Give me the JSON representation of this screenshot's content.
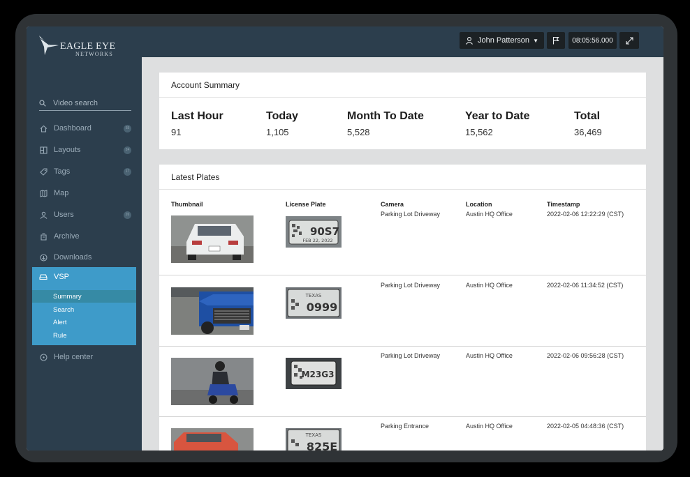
{
  "brand": {
    "name": "EAGLE EYE",
    "sub": "NETWORKS"
  },
  "header": {
    "user_name": "John Patterson",
    "clock": "08:05:56.000"
  },
  "sidebar": {
    "search_label": "Video search",
    "items": [
      {
        "label": "Dashboard",
        "badge": "55",
        "icon": "home-icon"
      },
      {
        "label": "Layouts",
        "badge": "24",
        "icon": "layouts-icon"
      },
      {
        "label": "Tags",
        "badge": "17",
        "icon": "tag-icon"
      },
      {
        "label": "Map",
        "badge": "",
        "icon": "map-icon"
      },
      {
        "label": "Users",
        "badge": "26",
        "icon": "user-icon"
      },
      {
        "label": "Archive",
        "badge": "",
        "icon": "archive-icon"
      },
      {
        "label": "Downloads",
        "badge": "",
        "icon": "download-icon"
      }
    ],
    "vsp": {
      "label": "VSP",
      "sub": [
        "Summary",
        "Search",
        "Alert",
        "Rule"
      ],
      "active": "Summary"
    },
    "help_label": "Help center"
  },
  "summary": {
    "title": "Account Summary",
    "stats": [
      {
        "label": "Last Hour",
        "value": "91"
      },
      {
        "label": "Today",
        "value": "1,105"
      },
      {
        "label": "Month To Date",
        "value": "5,528"
      },
      {
        "label": "Year to Date",
        "value": "15,562"
      },
      {
        "label": "Total",
        "value": "36,469"
      }
    ]
  },
  "plates": {
    "title": "Latest Plates",
    "columns": [
      "Thumbnail",
      "License Plate",
      "Camera",
      "Location",
      "Timestamp"
    ],
    "rows": [
      {
        "plate_text": "90S7",
        "plate_sub": "FEB 22, 2022",
        "camera": "Parking Lot Driveway",
        "location": "Austin HQ Office",
        "timestamp": "2022-02-06 12:22:29 (CST)"
      },
      {
        "plate_text": "0999",
        "plate_sub": "TEXAS",
        "camera": "Parking Lot Driveway",
        "location": "Austin HQ Office",
        "timestamp": "2022-02-06 11:34:52 (CST)"
      },
      {
        "plate_text": "M23G3",
        "plate_sub": "",
        "camera": "Parking Lot Driveway",
        "location": "Austin HQ Office",
        "timestamp": "2022-02-06 09:56:28 (CST)"
      },
      {
        "plate_text": "825E",
        "plate_sub": "TEXAS",
        "camera": "Parking Entrance",
        "location": "Austin HQ Office",
        "timestamp": "2022-02-05 04:48:36 (CST)"
      }
    ]
  }
}
